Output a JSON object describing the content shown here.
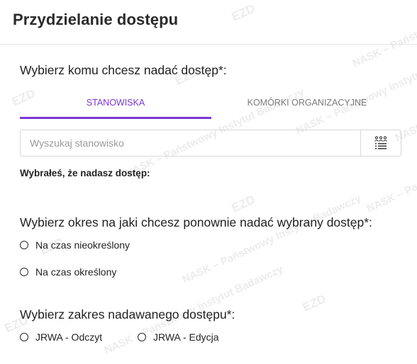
{
  "header": {
    "title": "Przydzielanie dostępu"
  },
  "watermark": {
    "brand": "EZD",
    "text": "NASK – Państwowy Instytut Badawczy"
  },
  "access": {
    "prompt": "Wybierz komu chcesz nadać dostęp*:",
    "tabs": [
      {
        "label": "STANOWISKA",
        "active": true
      },
      {
        "label": "KOMÓRKI ORGANIZACYJNE",
        "active": false
      }
    ],
    "search": {
      "placeholder": "Wyszukaj stanowisko",
      "value": ""
    },
    "list_button_icon": "people-list-icon",
    "selected_label": "Wybrałeś, że nadasz dostęp:"
  },
  "period": {
    "prompt": "Wybierz okres na jaki chcesz ponownie nadać wybrany dostęp*:",
    "options": [
      {
        "label": "Na czas nieokreślony",
        "checked": false
      },
      {
        "label": "Na czas określony",
        "checked": false
      }
    ]
  },
  "scope": {
    "prompt": "Wybierz zakres nadawanego dostępu*:",
    "options": [
      {
        "label": "JRWA - Odczyt",
        "checked": false
      },
      {
        "label": "JRWA - Edycja",
        "checked": false
      }
    ]
  },
  "colors": {
    "accent": "#7a36d6",
    "text": "#222222",
    "border": "#d8d8d8",
    "muted": "#7a7a7a"
  }
}
